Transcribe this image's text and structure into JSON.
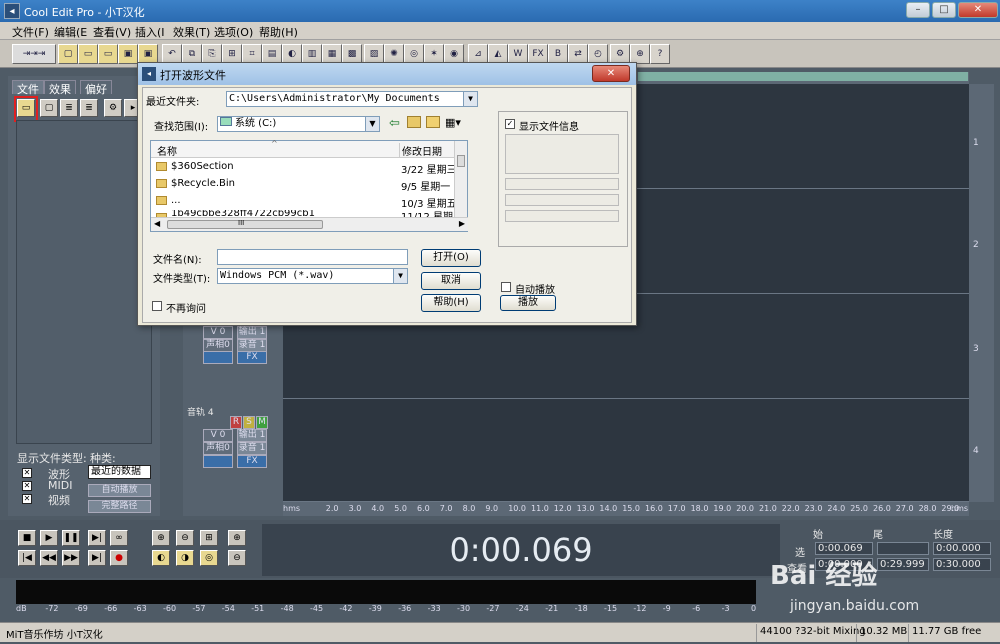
{
  "window": {
    "title": "Cool Edit Pro  - 小T汉化",
    "icon": "app-icon",
    "min": "–",
    "max": "□",
    "close": "✕"
  },
  "menu": [
    "文件(F)",
    "编辑(E",
    "查看(V)",
    "插入(I",
    "效果(T)",
    "选项(O)",
    "帮助(H)"
  ],
  "panel": {
    "tabs": [
      "文件",
      "效果",
      "偏好"
    ],
    "show_types_label": "显示文件类型:",
    "kind_label": "种类:",
    "types": [
      "波形",
      "MIDI",
      "视频"
    ],
    "sort_value": "最近的数据",
    "auto_play": "自动播放",
    "full_path": "完整路径"
  },
  "tracks": [
    {
      "name": "音轨 4",
      "vol": "V 0",
      "pan": "声相0",
      "out": "输出 1",
      "rec": "录音 1",
      "fx": "FX"
    },
    {
      "vol": "V 0",
      "pan": "声相0",
      "out": "输出 1",
      "rec": "录音 1",
      "fx": "FX"
    }
  ],
  "lanes": [
    "1",
    "2",
    "3",
    "4"
  ],
  "ruler": [
    "hms",
    "2.0",
    "3.0",
    "4.0",
    "5.0",
    "6.0",
    "7.0",
    "8.0",
    "9.0",
    "10.0",
    "11.0",
    "12.0",
    "13.0",
    "14.0",
    "15.0",
    "16.0",
    "17.0",
    "18.0",
    "19.0",
    "20.0",
    "21.0",
    "22.0",
    "23.0",
    "24.0",
    "25.0",
    "26.0",
    "27.0",
    "28.0",
    "29.0",
    "hms"
  ],
  "time_display": "0:00.069",
  "selection": {
    "h_begin": "始",
    "h_end": "尾",
    "h_len": "长度",
    "sel": "选",
    "view": "查看",
    "sel_begin": "0:00.069",
    "sel_end": "",
    "sel_len": "0:00.000",
    "view_begin": "0:00.000",
    "view_end": "0:29.999",
    "view_len": "0:30.000"
  },
  "meter": [
    "dB",
    "-72",
    "-69",
    "-66",
    "-63",
    "-60",
    "-57",
    "-54",
    "-51",
    "-48",
    "-45",
    "-42",
    "-39",
    "-36",
    "-33",
    "-30",
    "-27",
    "-24",
    "-21",
    "-18",
    "-15",
    "-12",
    "-9",
    "-6",
    "-3",
    "0"
  ],
  "status": {
    "left": "MiT音乐作坊 小T汉化",
    "rate": "44100 ?32-bit Mixing",
    "mem": "10.32 MB",
    "free": "11.77 GB free"
  },
  "dialog": {
    "title": "打开波形文件",
    "recent_label": "最近文件夹:",
    "recent_value": "C:\\Users\\Administrator\\My Documents",
    "lookin_label": "查找范围(I):",
    "lookin_value": "系统 (C:)",
    "col_name": "名称",
    "col_date": "修改日期",
    "files": [
      {
        "name": "$360Section",
        "date": "3/22 星期三"
      },
      {
        "name": "$Recycle.Bin",
        "date": "9/5 星期一 1"
      },
      {
        "name": "...",
        "date": "10/3 星期五"
      },
      {
        "name": "1b49cbbe328ff4722cb99cb1",
        "date": "11/12 星期三"
      }
    ],
    "hscroll_mark": "III",
    "filename_label": "文件名(N):",
    "filename_value": "",
    "filetype_label": "文件类型(T):",
    "filetype_value": "Windows PCM (*.wav)",
    "open_btn": "打开(O)",
    "cancel_btn": "取消",
    "help_btn": "帮助(H)",
    "no_ask": "不再询问",
    "show_info": "显示文件信息",
    "auto_play": "自动播放",
    "play_btn": "播放"
  },
  "watermark": {
    "main": "Bai 经验",
    "sub": "jingyan.baidu.com"
  }
}
